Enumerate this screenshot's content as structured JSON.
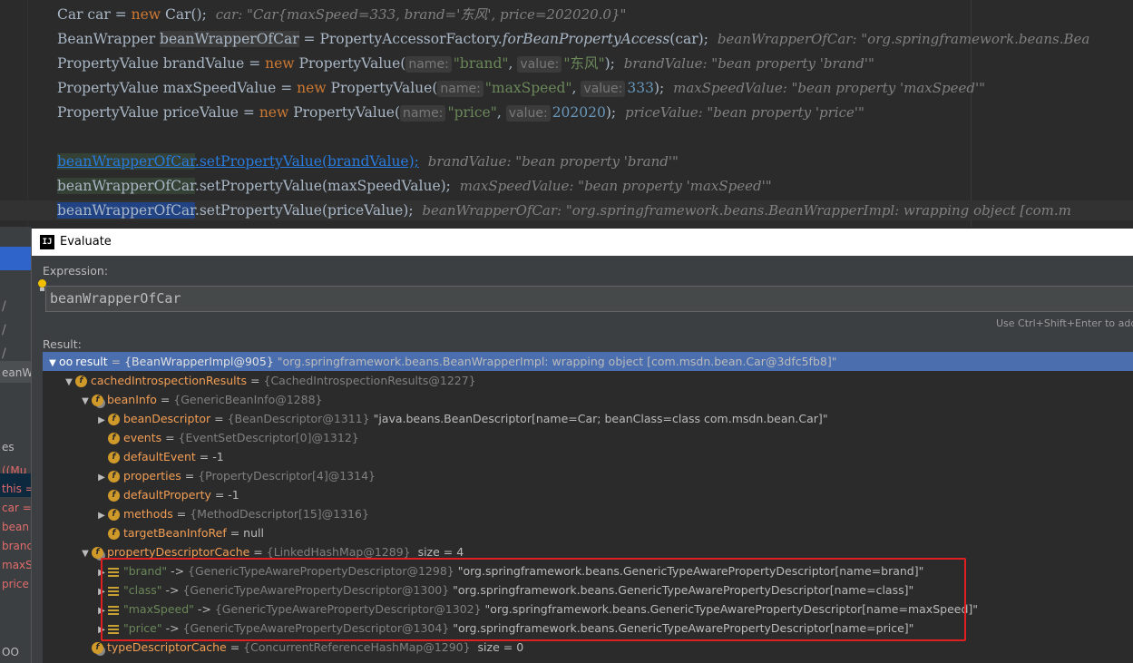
{
  "editor": {
    "lines": [
      {
        "seg": [
          "Car car = ",
          "new",
          " Car();",
          "car: \"Car{maxSpeed=333, brand='东风', price=202020.0}\""
        ]
      },
      {
        "seg": [
          "BeanWrapper ",
          "beanWrapperOfCar",
          " = PropertyAccessorFactory.",
          "forBeanPropertyAccess",
          "(car);",
          "beanWrapperOfCar: \"org.springframework.beans.Bea"
        ]
      },
      {
        "seg": [
          "PropertyValue brandValue = ",
          "new",
          " PropertyValue(",
          "name:",
          "\"brand\"",
          ", ",
          "value:",
          "\"东风\"",
          ");",
          "brandValue: \"bean property 'brand'\""
        ]
      },
      {
        "seg": [
          "PropertyValue maxSpeedValue = ",
          "new",
          " PropertyValue(",
          "name:",
          "\"maxSpeed\"",
          ", ",
          "value:",
          "333",
          ");",
          "maxSpeedValue: \"bean property 'maxSpeed'\""
        ]
      },
      {
        "seg": [
          "PropertyValue priceValue = ",
          "new",
          " PropertyValue(",
          "name:",
          "\"price\"",
          ", ",
          "value:",
          "202020",
          ");",
          "priceValue: \"bean property 'price'\""
        ]
      },
      {
        "seg": [
          "beanWrapperOfCar",
          ".setPropertyValue(brandValue);",
          "brandValue: \"bean property 'brand'\""
        ]
      },
      {
        "seg": [
          "beanWrapperOfCar",
          ".setPropertyValue(maxSpeedValue);",
          "maxSpeedValue: \"bean property 'maxSpeed'\""
        ]
      },
      {
        "seg": [
          "beanWrapperOfCar",
          ".setPropertyValue(priceValue);",
          "beanWrapperOfCar: \"org.springframework.beans.BeanWrapperImpl: wrapping object [com.m"
        ]
      }
    ]
  },
  "left_strip": {
    "items": [
      "eanW",
      "es",
      "((Mu",
      "this =",
      "car =",
      "bean",
      "branc",
      "maxS",
      "price",
      "OO"
    ]
  },
  "dialog": {
    "title": "Evaluate",
    "logo": "IJ",
    "expression_label": "Expression:",
    "expression_value": "beanWrapperOfCar",
    "shortcut_hint": "Use Ctrl+Shift+Enter to add t",
    "result_label": "Result:"
  },
  "tree": [
    {
      "arrow": "▼",
      "icon": "oo",
      "name": "result",
      "sep": " = ",
      "meta": "{BeanWrapperImpl@905}",
      "val": " \"org.springframework.beans.BeanWrapperImpl: wrapping object [com.msdn.bean.Car@3dfc5fb8]\""
    },
    {
      "arrow": "▼",
      "icon": "f",
      "name": "cachedIntrospectionResults",
      "sep": " = ",
      "meta": "{CachedIntrospectionResults@1227}",
      "val": ""
    },
    {
      "arrow": "▼",
      "icon": "f",
      "name": "beanInfo",
      "sep": " = ",
      "meta": "{GenericBeanInfo@1288}",
      "val": ""
    },
    {
      "arrow": "▶",
      "icon": "f",
      "name": "beanDescriptor",
      "sep": " = ",
      "meta": "{BeanDescriptor@1311}",
      "val": " \"java.beans.BeanDescriptor[name=Car; beanClass=class com.msdn.bean.Car]\""
    },
    {
      "arrow": "",
      "icon": "f",
      "name": "events",
      "sep": " = ",
      "meta": "{EventSetDescriptor[0]@1312}",
      "val": ""
    },
    {
      "arrow": "",
      "icon": "f",
      "name": "defaultEvent",
      "sep": " = ",
      "meta": "",
      "val": "-1"
    },
    {
      "arrow": "▶",
      "icon": "f",
      "name": "properties",
      "sep": " = ",
      "meta": "{PropertyDescriptor[4]@1314}",
      "val": ""
    },
    {
      "arrow": "",
      "icon": "f",
      "name": "defaultProperty",
      "sep": " = ",
      "meta": "",
      "val": "-1"
    },
    {
      "arrow": "▶",
      "icon": "f",
      "name": "methods",
      "sep": " = ",
      "meta": "{MethodDescriptor[15]@1316}",
      "val": ""
    },
    {
      "arrow": "",
      "icon": "f",
      "name": "targetBeanInfoRef",
      "sep": " = ",
      "meta": "",
      "val": "null"
    },
    {
      "arrow": "▼",
      "icon": "f",
      "name": "propertyDescriptorCache",
      "sep": " = ",
      "meta": "{LinkedHashMap@1289}",
      "val": "  size = 4"
    },
    {
      "arrow": "▶",
      "icon": "entry",
      "key": "\"brand\"",
      "sep": " -> ",
      "meta": "{GenericTypeAwarePropertyDescriptor@1298}",
      "val": " \"org.springframework.beans.GenericTypeAwarePropertyDescriptor[name=brand]\""
    },
    {
      "arrow": "▶",
      "icon": "entry",
      "key": "\"class\"",
      "sep": " -> ",
      "meta": "{GenericTypeAwarePropertyDescriptor@1300}",
      "val": " \"org.springframework.beans.GenericTypeAwarePropertyDescriptor[name=class]\""
    },
    {
      "arrow": "▶",
      "icon": "entry",
      "key": "\"maxSpeed\"",
      "sep": " -> ",
      "meta": "{GenericTypeAwarePropertyDescriptor@1302}",
      "val": " \"org.springframework.beans.GenericTypeAwarePropertyDescriptor[name=maxSpeed]\""
    },
    {
      "arrow": "▶",
      "icon": "entry",
      "key": "\"price\"",
      "sep": " -> ",
      "meta": "{GenericTypeAwarePropertyDescriptor@1304}",
      "val": " \"org.springframework.beans.GenericTypeAwarePropertyDescriptor[name=price]\""
    },
    {
      "arrow": "",
      "icon": "f",
      "name": "typeDescriptorCache",
      "sep": " = ",
      "meta": "{ConcurrentReferenceHashMap@1290}",
      "val": "  size = 0"
    }
  ],
  "icons": {
    "field": "field-icon",
    "map_entry": "map-entry-icon",
    "infinity": "watch-result-icon",
    "bulb": "lightbulb-icon"
  },
  "colors": {
    "highlight_box": "#e02020",
    "selection": "#4b6eaf",
    "field_name": "#f29e55",
    "string": "#6a8759",
    "keyword": "#cc7832",
    "number": "#6897bb"
  }
}
